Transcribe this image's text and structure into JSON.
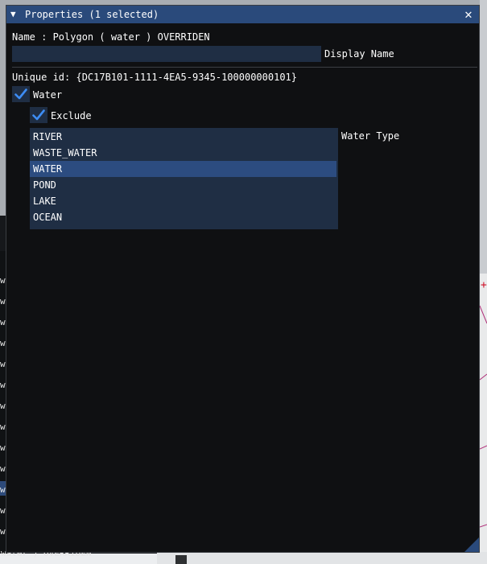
{
  "dialog": {
    "title": "Properties (1 selected)",
    "collapse_glyph": "▼",
    "close_glyph": "✕",
    "name_line": "Name : Polygon  ( water ) OVERRIDEN",
    "display_name": {
      "value": "",
      "label": "Display Name"
    },
    "unique_id_line": "Unique id: {DC17B101-1111-4EA5-9345-100000000101}",
    "water": {
      "label": "Water",
      "checked": true
    },
    "exclude": {
      "label": "Exclude",
      "checked": true
    },
    "water_type": {
      "label": "Water Type",
      "selected": "WATER",
      "options": [
        "RIVER",
        "WASTE_WATER",
        "WATER",
        "POND",
        "LAKE",
        "OCEAN"
      ]
    }
  },
  "background": {
    "row_letters": [
      "w",
      "w",
      "w",
      "w",
      "w",
      "w",
      "w",
      "w",
      "w",
      "w",
      "w",
      "w",
      "w"
    ],
    "status_text": "water ) OVERRIDEN"
  },
  "colors": {
    "title_bar": "#2a4a7b",
    "window_bg": "#0f1012",
    "input_bg": "#1f2e44",
    "selected_item": "#2c4c80",
    "check": "#3d8df5"
  },
  "icons": {
    "collapse": "triangle-down-icon",
    "close": "close-icon",
    "check": "checkmark-icon"
  }
}
